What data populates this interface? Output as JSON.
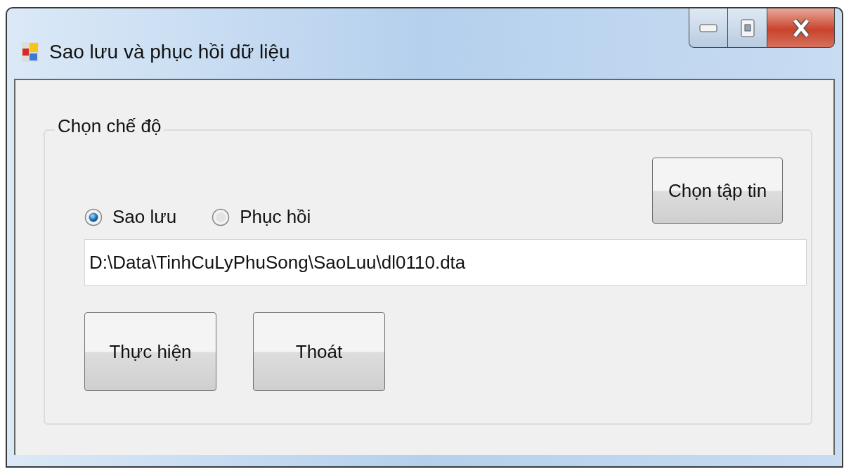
{
  "window": {
    "title": "Sao lưu và phục hồi dữ liệu"
  },
  "group": {
    "title": "Chọn chế độ",
    "modes": [
      {
        "label": "Sao lưu",
        "selected": true
      },
      {
        "label": "Phục hồi",
        "selected": false
      }
    ],
    "choose_file_button": "Chọn tập tin",
    "path_field": {
      "value": "D:\\Data\\TinhCuLyPhuSong\\SaoLuu\\dl0110.dta"
    },
    "buttons": [
      "Thực hiện",
      "Thoát"
    ]
  }
}
